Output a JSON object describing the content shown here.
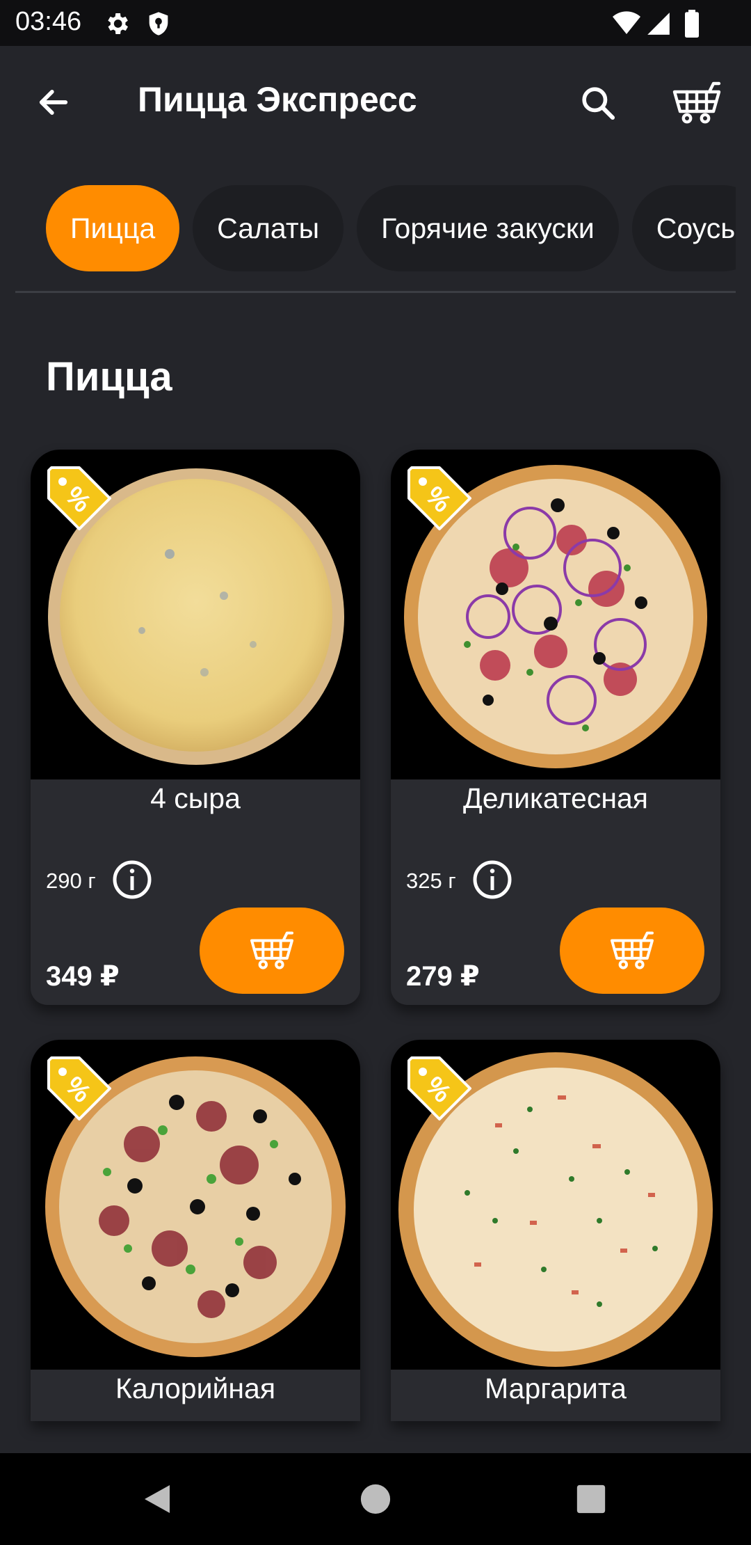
{
  "status_bar": {
    "time": "03:46",
    "icons": [
      "gear-icon",
      "shield-icon",
      "wifi-icon",
      "signal-icon",
      "battery-icon"
    ]
  },
  "app_bar": {
    "title": "Пицца Экспресс",
    "icons": [
      "back-arrow-icon",
      "search-icon",
      "cart-icon"
    ]
  },
  "categories": [
    {
      "label": "Пицца",
      "active": true
    },
    {
      "label": "Салаты",
      "active": false
    },
    {
      "label": "Горячие закуски",
      "active": false
    },
    {
      "label": "Соусы",
      "active": false
    }
  ],
  "section": {
    "title": "Пицца"
  },
  "products": [
    {
      "name": "4 сыра",
      "weight": "290 г",
      "price": "349 ₽",
      "discount_icon": "discount-tag-icon"
    },
    {
      "name": "Деликатесная",
      "weight": "325 г",
      "price": "279 ₽",
      "discount_icon": "discount-tag-icon"
    },
    {
      "name": "Калорийная",
      "discount_icon": "discount-tag-icon"
    },
    {
      "name": "Маргарита",
      "discount_icon": "discount-tag-icon"
    }
  ],
  "colors": {
    "accent": "#ff8c00",
    "background": "#24252a",
    "card": "#2a2b30",
    "chip": "#1d1e22",
    "tag": "#f5c518"
  }
}
